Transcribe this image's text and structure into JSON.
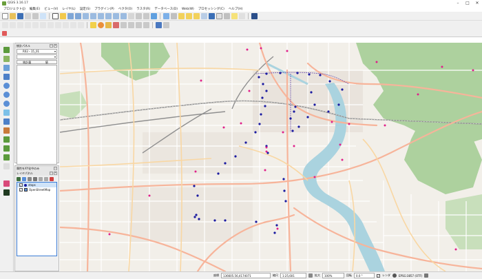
{
  "window": {
    "title": "QGIS 3.16.17"
  },
  "menu": [
    "プロジェクト(J)",
    "編集(E)",
    "ビュー(V)",
    "レイヤ(L)",
    "設定(S)",
    "プラグイン(P)",
    "ベクタ(O)",
    "ラスタ(R)",
    "データベース(D)",
    "Web(W)",
    "プロセッシング(C)",
    "ヘルプ(H)"
  ],
  "browser_panel": {
    "title": "統計パネル",
    "layer_combo": "R02・15_01",
    "col1": "統計量",
    "col2": "値"
  },
  "layers_panel": {
    "tab_label": "属性をXY化中のみ",
    "title": "レイヤパネル",
    "layers": [
      {
        "name": "stops",
        "checked": true,
        "selected": true,
        "symbol": "point"
      },
      {
        "name": "OpenStreetMap",
        "checked": true,
        "selected": false,
        "symbol": "raster"
      }
    ]
  },
  "statusbar": {
    "coord_label": "座標",
    "coord_value": "136605.56,4174071",
    "scale_label": "縮尺",
    "scale_value": "1:25,601",
    "magnifier_label": "拡大",
    "magnifier_value": "100%",
    "rotation_label": "回転",
    "rotation_value": "0.0 °",
    "render_label": "レンダ",
    "crs": "EPSG:3857 (OTF)"
  },
  "colors": {
    "stop_point": "#1a1aa0",
    "poi_point": "#e0208a",
    "river": "#aad3df",
    "park": "#b7d9a8",
    "forest": "#add19e",
    "primary_road": "#f7b49a",
    "secondary_road": "#f9d7a3"
  }
}
